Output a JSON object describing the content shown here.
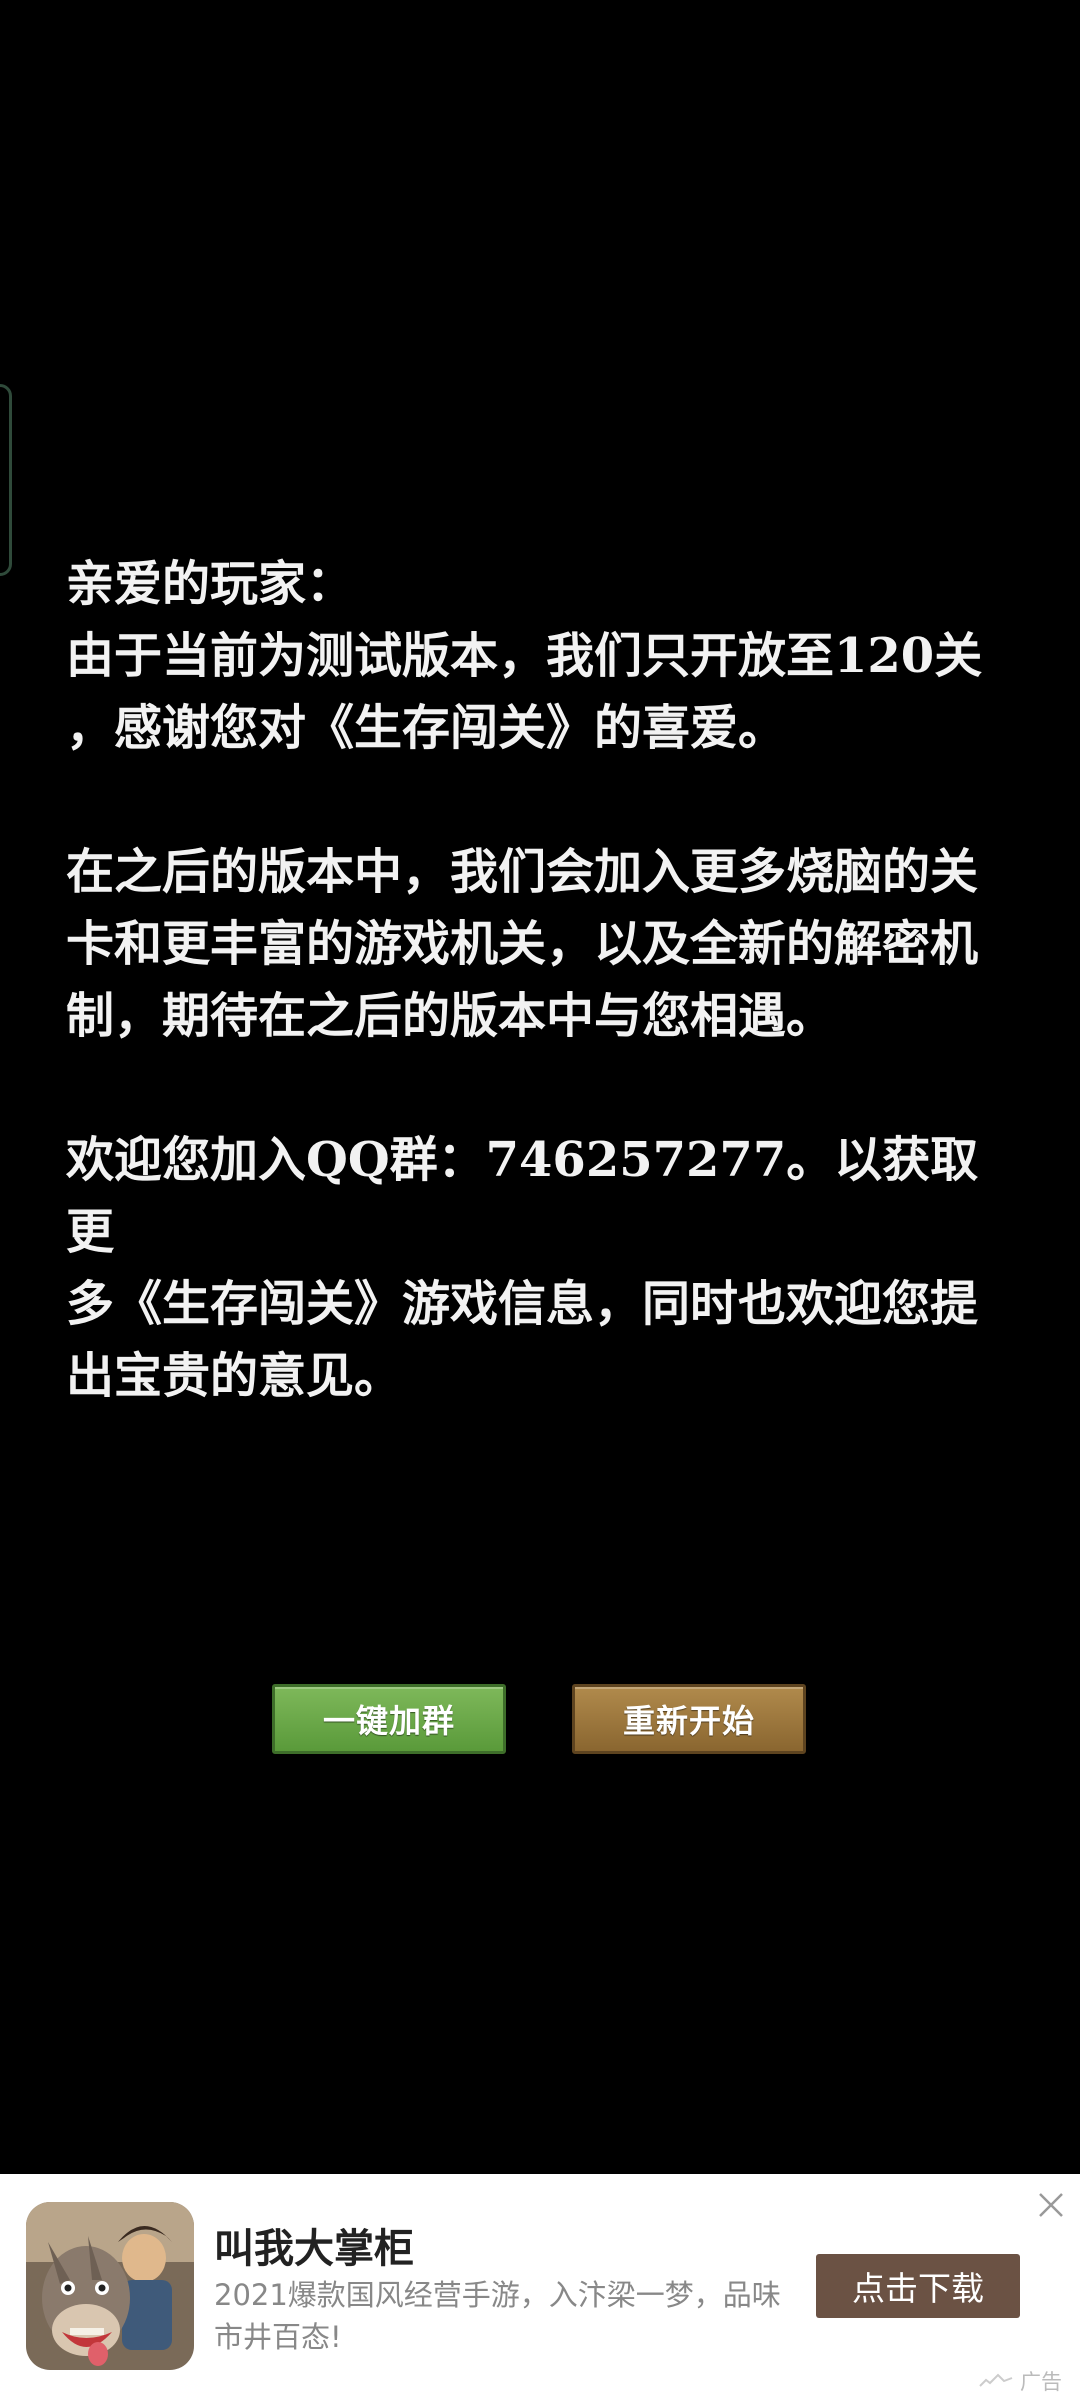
{
  "message": {
    "greeting": "亲爱的玩家：",
    "para1_line1": "由于当前为测试版本，我们只开放至120关",
    "para1_line2": "，感谢您对《生存闯关》的喜爱。",
    "para2_line1": "在之后的版本中，我们会加入更多烧脑的关",
    "para2_line2": "卡和更丰富的游戏机关，以及全新的解密机",
    "para2_line3": "制，期待在之后的版本中与您相遇。",
    "para3_line1": "欢迎您加入QQ群：746257277。以获取更",
    "para3_line2": "多《生存闯关》游戏信息，同时也欢迎您提",
    "para3_line3": "出宝贵的意见。"
  },
  "buttons": {
    "join_group": "一键加群",
    "restart": "重新开始"
  },
  "ad": {
    "title": "叫我大掌柜",
    "description": "2021爆款国风经营手游，入汴梁一梦，品味市井百态!",
    "download_label": "点击下载",
    "ad_label": "广告",
    "icon": "donkey-game-icon"
  },
  "colors": {
    "background": "#000000",
    "text": "#f2f2f2",
    "join_button": "#6aa848",
    "restart_button": "#9c7a40",
    "download_button": "#6b5244"
  }
}
